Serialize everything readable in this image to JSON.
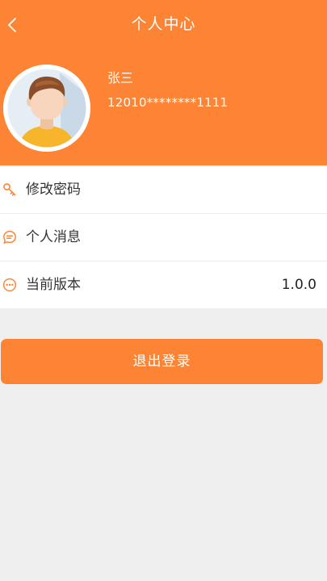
{
  "header": {
    "title": "个人中心",
    "back_icon": "chevron-left-icon"
  },
  "profile": {
    "name": "张三",
    "account": "12010********1111",
    "avatar_icon": "avatar-boy-illustration"
  },
  "menu": {
    "items": [
      {
        "label": "修改密码",
        "icon": "key-icon",
        "value": ""
      },
      {
        "label": "个人消息",
        "icon": "message-icon",
        "value": ""
      },
      {
        "label": "当前版本",
        "icon": "more-dots-icon",
        "value": "1.0.0"
      }
    ]
  },
  "logout": {
    "label": "退出登录"
  },
  "colors": {
    "accent": "#fe8435",
    "background": "#efefef",
    "text": "#333333"
  }
}
